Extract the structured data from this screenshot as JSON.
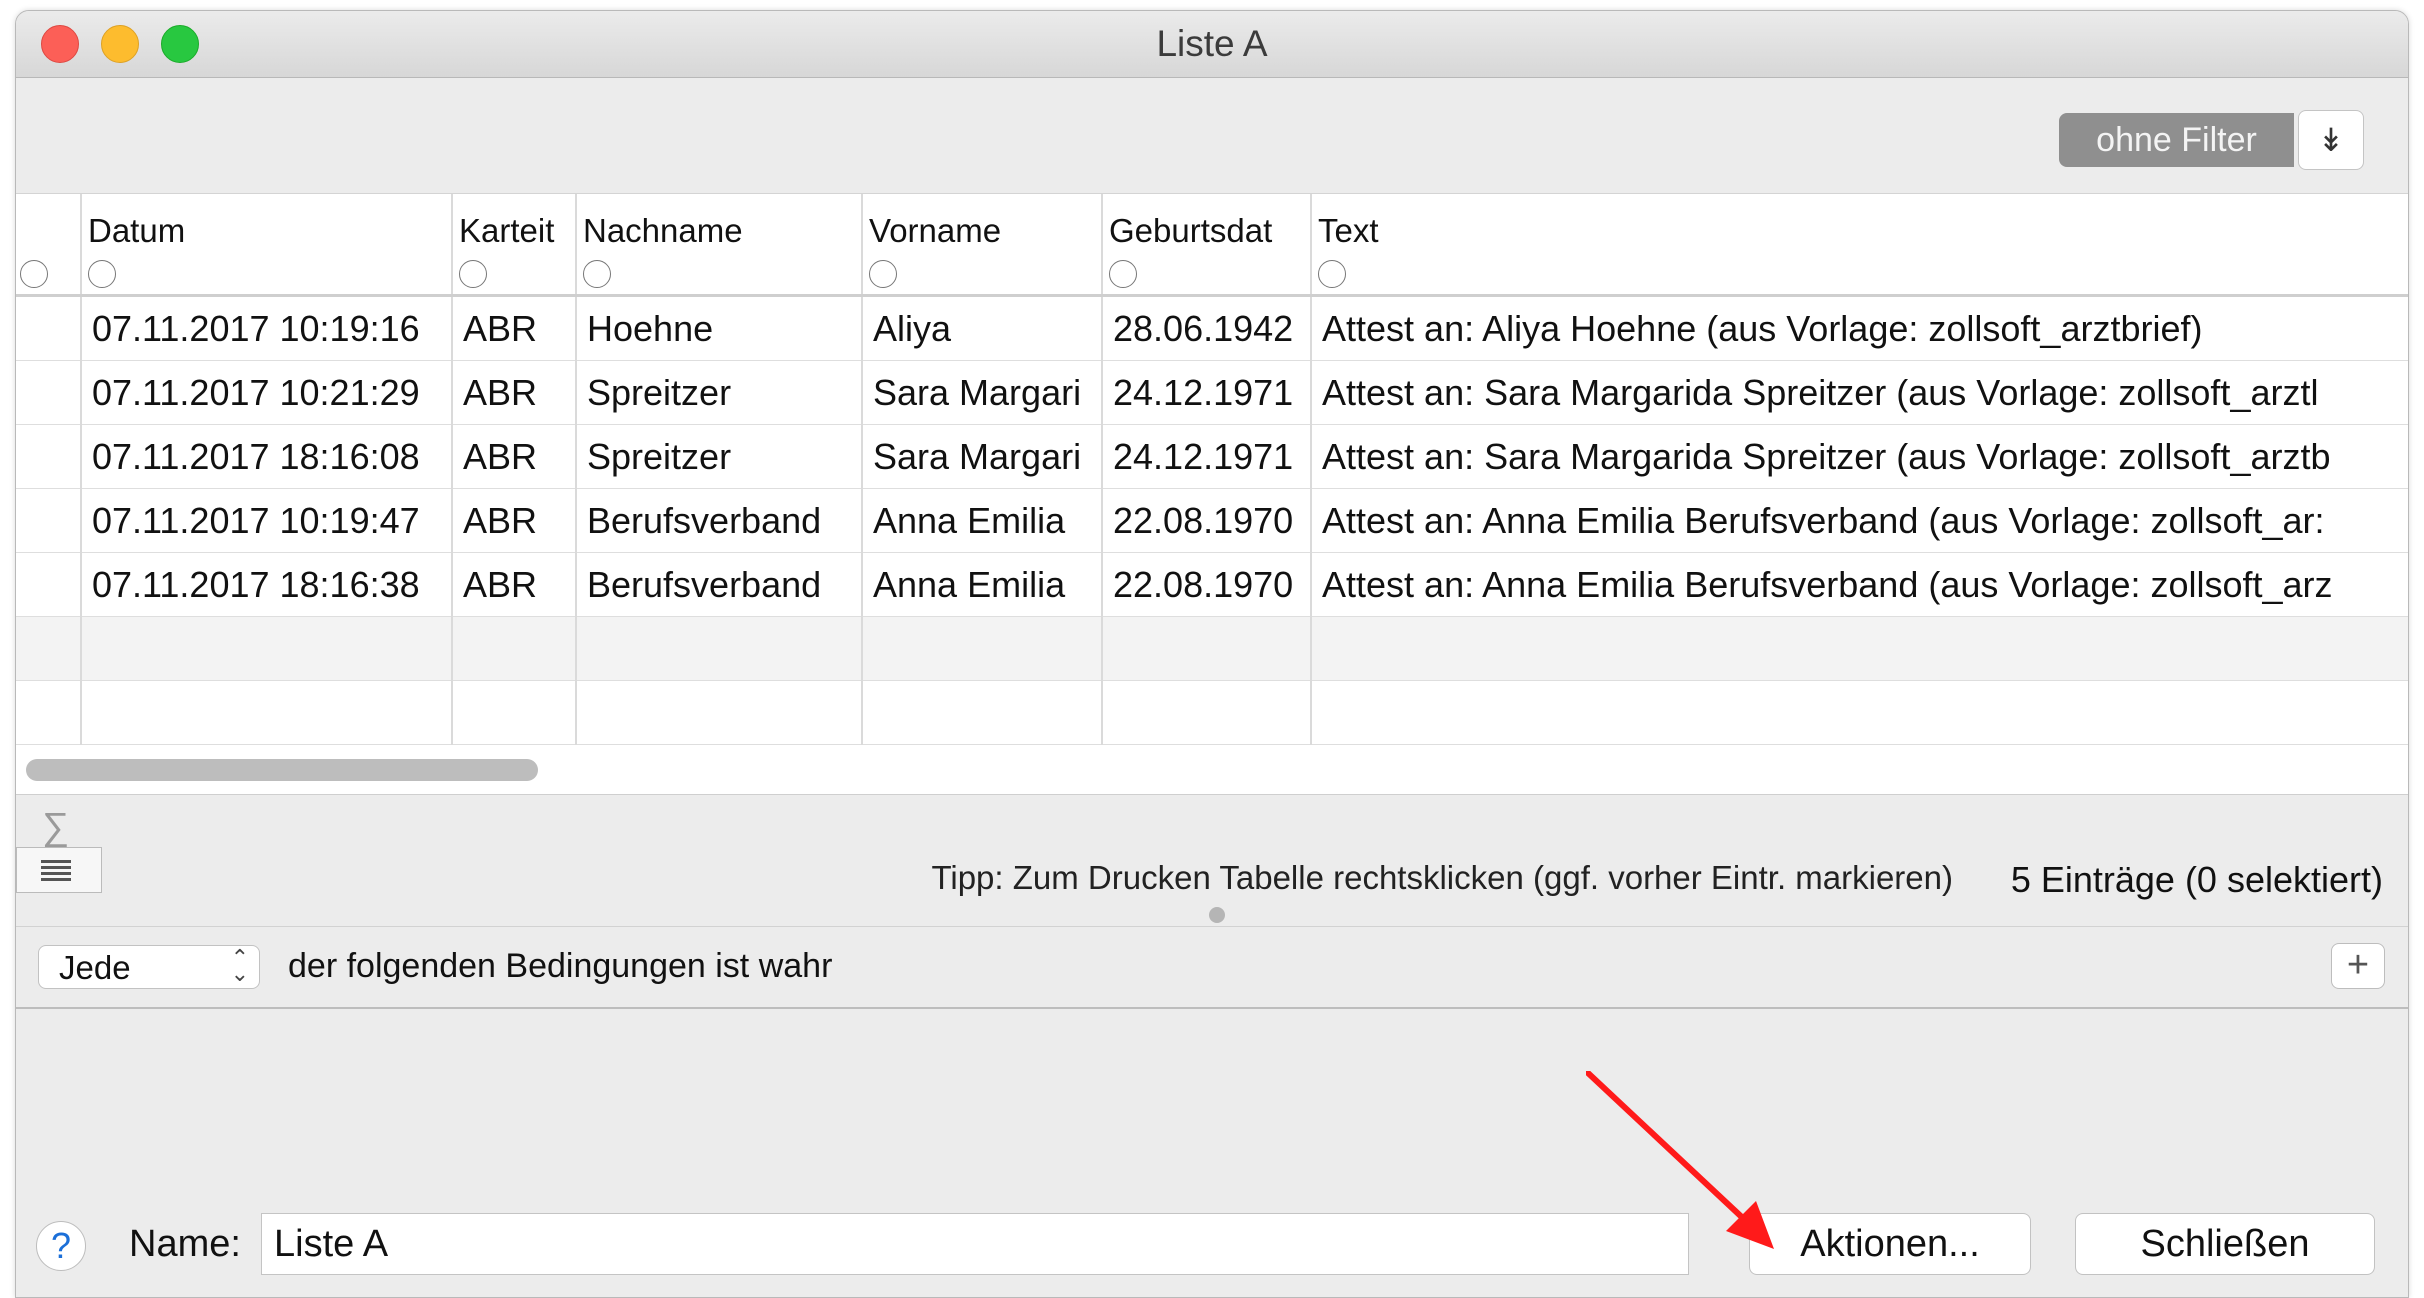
{
  "window": {
    "title": "Liste A"
  },
  "toolbar": {
    "filter_label": "ohne Filter",
    "filter_menu_icon": "double-chevron-down-icon"
  },
  "table": {
    "columns": [
      "Datum",
      "Karteit",
      "Nachname",
      "Vorname",
      "Geburtsdat",
      "Text"
    ],
    "rows": [
      [
        "07.11.2017 10:19:16",
        "ABR",
        "Hoehne",
        "Aliya",
        "28.06.1942",
        "Attest an: Aliya Hoehne (aus Vorlage: zollsoft_arztbrief)"
      ],
      [
        "07.11.2017 10:21:29",
        "ABR",
        "Spreitzer",
        "Sara Margari",
        "24.12.1971",
        "Attest  an: Sara Margarida Spreitzer (aus Vorlage: zollsoft_arztl"
      ],
      [
        "07.11.2017 18:16:08",
        "ABR",
        "Spreitzer",
        "Sara Margari",
        "24.12.1971",
        "Attest an: Sara Margarida Spreitzer (aus Vorlage: zollsoft_arztb"
      ],
      [
        "07.11.2017 10:19:47",
        "ABR",
        "Berufsverband",
        "Anna Emilia",
        "22.08.1970",
        "Attest  an: Anna Emilia Berufsverband (aus Vorlage: zollsoft_ar:"
      ],
      [
        "07.11.2017 18:16:38",
        "ABR",
        "Berufsverband",
        "Anna Emilia",
        "22.08.1970",
        "Attest an: Anna Emilia Berufsverband (aus Vorlage: zollsoft_arz"
      ]
    ]
  },
  "footer_info": {
    "sigma": "∑",
    "tip": "Tipp: Zum Drucken Tabelle rechtsklicken (ggf. vorher Eintr. markieren)",
    "count": "5 Einträge (0 selektiert)"
  },
  "conditions": {
    "match_select": "Jede",
    "text": "der folgenden Bedingungen ist wahr",
    "add_label": "+"
  },
  "bottom": {
    "help_label": "?",
    "name_label": "Name:",
    "name_value": "Liste A",
    "actions_label": "Aktionen...",
    "close_label": "Schließen"
  },
  "colors": {
    "annotation_arrow": "#ff1a1a",
    "filter_pill": "#8f8f8f"
  }
}
